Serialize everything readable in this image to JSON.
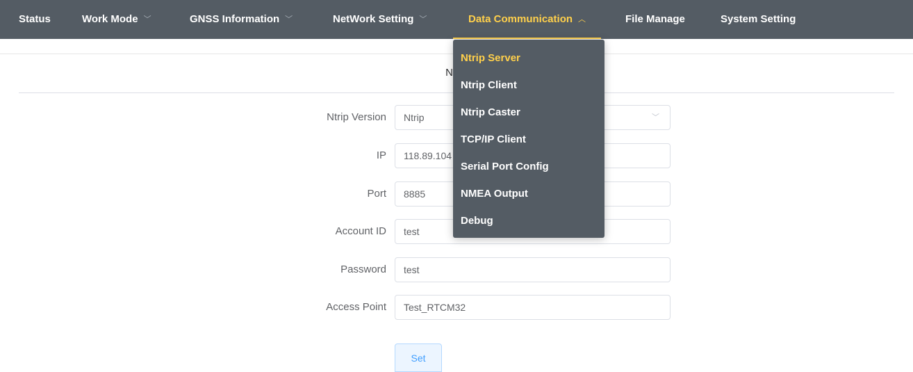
{
  "nav": {
    "items": [
      {
        "label": "Status",
        "has_submenu": false,
        "active": false
      },
      {
        "label": "Work Mode",
        "has_submenu": true,
        "active": false
      },
      {
        "label": "GNSS Information",
        "has_submenu": true,
        "active": false
      },
      {
        "label": "NetWork Setting",
        "has_submenu": true,
        "active": false
      },
      {
        "label": "Data Communication",
        "has_submenu": true,
        "active": true
      },
      {
        "label": "File Manage",
        "has_submenu": false,
        "active": false
      },
      {
        "label": "System Setting",
        "has_submenu": false,
        "active": false
      }
    ],
    "chevron_down": "﹀",
    "chevron_up": "︿"
  },
  "dropdown": {
    "items": [
      {
        "label": "Ntrip Server",
        "active": true
      },
      {
        "label": "Ntrip Client",
        "active": false
      },
      {
        "label": "Ntrip Caster",
        "active": false
      },
      {
        "label": "TCP/IP Client",
        "active": false
      },
      {
        "label": "Serial Port Config",
        "active": false
      },
      {
        "label": "NMEA Output",
        "active": false
      },
      {
        "label": "Debug",
        "active": false
      }
    ]
  },
  "page": {
    "title": "Ntrip"
  },
  "form": {
    "ntrip_version": {
      "label": "Ntrip Version",
      "value": "Ntrip"
    },
    "ip": {
      "label": "IP",
      "value": "118.89.104"
    },
    "port": {
      "label": "Port",
      "value": "8885"
    },
    "account_id": {
      "label": "Account ID",
      "value": "test"
    },
    "password": {
      "label": "Password",
      "value": "test"
    },
    "access_point": {
      "label": "Access Point",
      "value": "Test_RTCM32"
    },
    "set_label": "Set"
  },
  "colors": {
    "nav_background": "#545c64",
    "active_accent": "#ffd04b",
    "button_text": "#409eff"
  }
}
